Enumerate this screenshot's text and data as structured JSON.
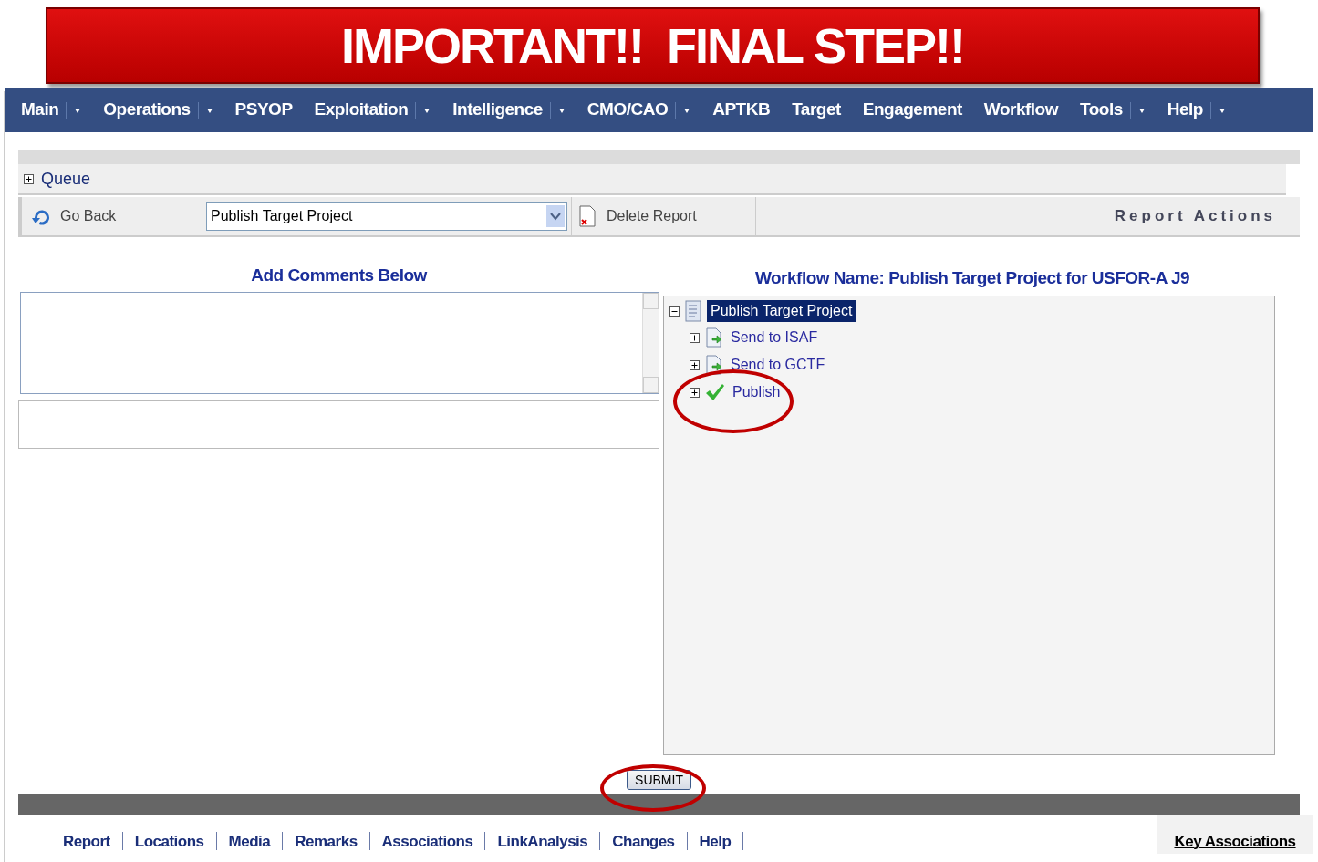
{
  "banner": {
    "title": "IMPORTANT!!  FINAL STEP!!"
  },
  "nav": [
    {
      "label": "Main",
      "has_menu": true
    },
    {
      "label": "Operations",
      "has_menu": true
    },
    {
      "label": "PSYOP",
      "has_menu": false
    },
    {
      "label": "Exploitation",
      "has_menu": true
    },
    {
      "label": "Intelligence",
      "has_menu": true
    },
    {
      "label": "CMO/CAO",
      "has_menu": true
    },
    {
      "label": "APTKB",
      "has_menu": false
    },
    {
      "label": "Target",
      "has_menu": false
    },
    {
      "label": "Engagement",
      "has_menu": false
    },
    {
      "label": "Workflow",
      "has_menu": false
    },
    {
      "label": "Tools",
      "has_menu": true
    },
    {
      "label": "Help",
      "has_menu": true
    }
  ],
  "queue": {
    "label": "Queue",
    "expanded": false
  },
  "toolbar": {
    "go_back": "Go Back",
    "select_value": "Publish Target Project",
    "delete": "Delete Report",
    "actions_title": "Report Actions"
  },
  "comments": {
    "heading": "Add Comments Below"
  },
  "workflow": {
    "heading": "Workflow Name: Publish Target Project for USFOR-A J9",
    "tree": {
      "label": "Publish Target Project",
      "selected": true,
      "expanded": true,
      "children": [
        {
          "label": "Send to ISAF",
          "kind": "send",
          "expanded": false,
          "selected": false
        },
        {
          "label": "Send to GCTF",
          "kind": "send",
          "expanded": false,
          "selected": false
        },
        {
          "label": "Publish",
          "kind": "done",
          "expanded": false,
          "selected": false
        }
      ]
    }
  },
  "submit": "SUBMIT",
  "bottom_tabs": [
    "Report",
    "Locations",
    "Media",
    "Remarks",
    "Associations",
    "LinkAnalysis",
    "Changes",
    "Help"
  ],
  "key_associations": "Key Associations"
}
